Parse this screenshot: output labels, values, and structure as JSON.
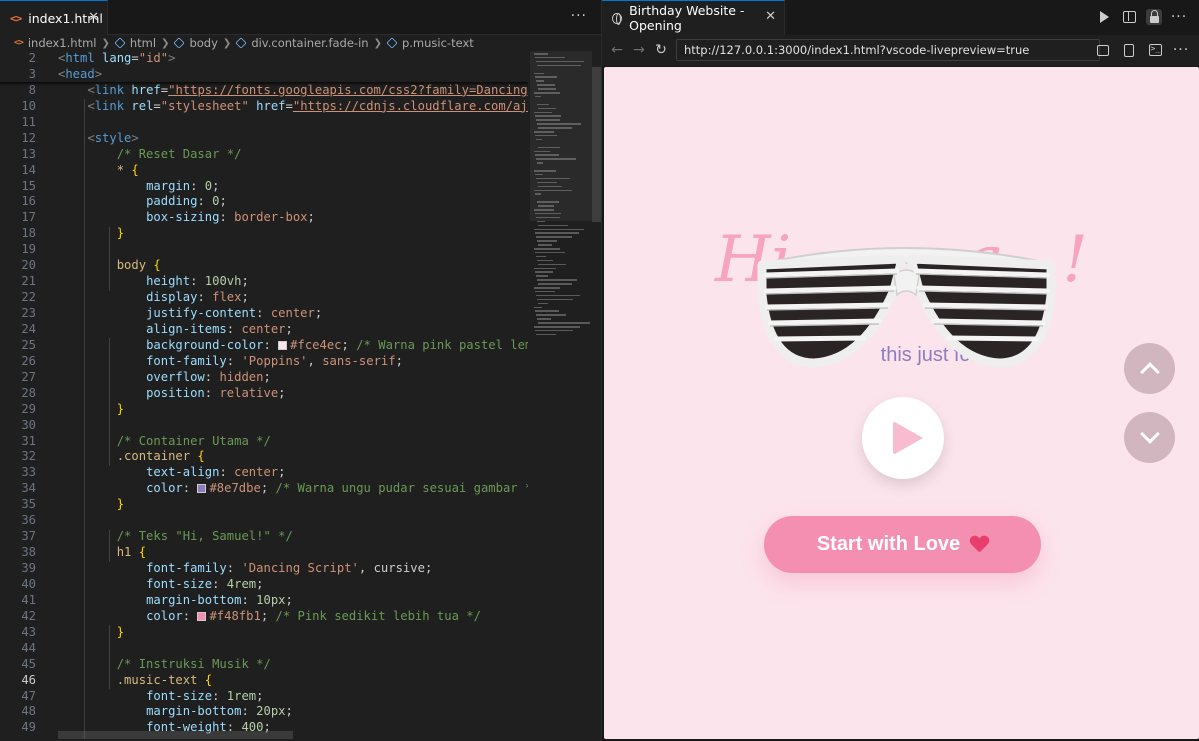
{
  "editor": {
    "tab_label": "index1.html",
    "tab_icon": "<>",
    "more": "···",
    "breadcrumb": [
      "index1.html",
      "html",
      "body",
      "div.container.fade-in",
      "p.music-text"
    ],
    "line_numbers": [
      "2",
      "3",
      "8",
      "10",
      "11",
      "12",
      "13",
      "14",
      "15",
      "16",
      "17",
      "18",
      "19",
      "20",
      "21",
      "22",
      "23",
      "24",
      "25",
      "26",
      "27",
      "28",
      "29",
      "30",
      "31",
      "32",
      "33",
      "34",
      "35",
      "36",
      "37",
      "38",
      "39",
      "40",
      "41",
      "42",
      "43",
      "44",
      "45",
      "46",
      "47",
      "48",
      "49"
    ],
    "code": {
      "l2_tag": "html",
      "l2_attr": "lang",
      "l2_val": "\"id\"",
      "l3_tag": "head",
      "l8_tag": "link",
      "l8_attr": "href",
      "l8_url": "\"https://fonts.googleapis.com/css2?family=Dancing+Script:w",
      "l10_tag": "link",
      "l10_attr1": "rel",
      "l10_val1": "\"stylesheet\"",
      "l10_attr2": "href",
      "l10_url": "\"https://cdnjs.cloudflare.com/ajax/libs/f",
      "l12_tag": "style",
      "l13": "/* Reset Dasar */",
      "l14_sel": "*",
      "l15_prop": "margin",
      "l15_val": "0",
      "l16_prop": "padding",
      "l16_val": "0",
      "l17_prop": "box-sizing",
      "l17_val": "border-box",
      "l20_sel": "body",
      "l21_prop": "height",
      "l21_val": "100vh",
      "l22_prop": "display",
      "l22_val": "flex",
      "l23_prop": "justify-content",
      "l23_val": "center",
      "l24_prop": "align-items",
      "l24_val": "center",
      "l25_prop": "background-color",
      "l25_val": "#fce4ec",
      "l25_com": "/* Warna pink pastel lembut */",
      "l26_prop": "font-family",
      "l26_val1": "'Poppins'",
      "l26_val2": "sans-serif",
      "l27_prop": "overflow",
      "l27_val": "hidden",
      "l28_prop": "position",
      "l28_val": "relative",
      "l31": "/* Container Utama */",
      "l32_sel": ".container",
      "l33_prop": "text-align",
      "l33_val": "center",
      "l34_prop": "color",
      "l34_val": "#8e7dbe",
      "l34_com": "/* Warna ungu pudar sesuai gambar */",
      "l37": "/* Teks \"Hi, Samuel!\" */",
      "l38_sel": "h1",
      "l39_prop": "font-family",
      "l39_val1": "'Dancing Script'",
      "l39_val2": "cursive",
      "l40_prop": "font-size",
      "l40_val": "4rem",
      "l41_prop": "margin-bottom",
      "l41_val": "10px",
      "l42_prop": "color",
      "l42_val": "#f48fb1",
      "l42_com": "/* Pink sedikit lebih tua */",
      "l45": "/* Instruksi Musik */",
      "l46_sel": ".music-text",
      "l47_prop": "font-size",
      "l47_val": "1rem",
      "l48_prop": "margin-bottom",
      "l48_val": "20px",
      "l49_prop": "font-weight",
      "l49_val": "400"
    },
    "swatch_colors": [
      "#fce4ec",
      "#8e7dbe",
      "#f48fb1"
    ]
  },
  "browser": {
    "tab_label": "Birthday Website - Opening",
    "url": "http://127.0.0.1:3000/index1.html?vscode-livepreview=true",
    "icons": [
      "run-icon",
      "split-icon",
      "lock-icon",
      "back-arrow-icon",
      "forward-arrow-icon",
      "refresh-icon",
      "open-external-icon",
      "document-icon",
      "terminal-icon"
    ],
    "more": "···"
  },
  "page": {
    "title_partial": "Hi",
    "title_tail": "g",
    "subtitle": "this just for",
    "start_button": "Start with Love",
    "colors": {
      "background": "#fce4ec",
      "title": "#f48fb1",
      "subtitle": "#8e7dbe",
      "button": "#f48fb1",
      "scroll_button": "#d1b6bf"
    }
  }
}
